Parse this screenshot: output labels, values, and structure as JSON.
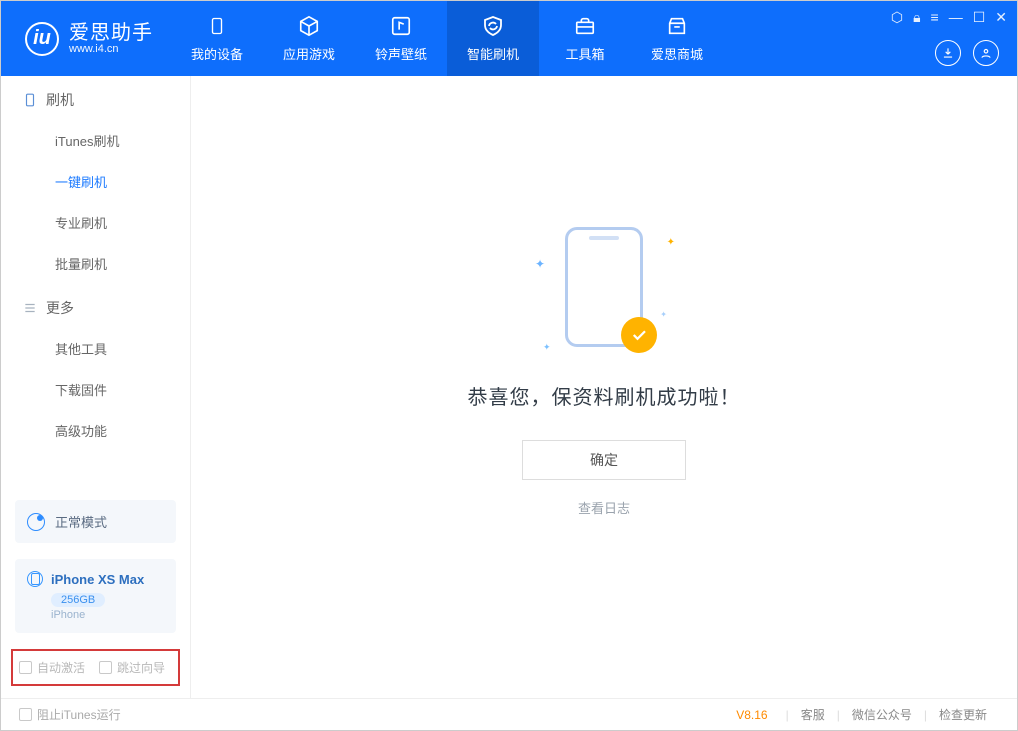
{
  "app": {
    "name": "爱思助手",
    "url": "www.i4.cn"
  },
  "nav": {
    "items": [
      {
        "label": "我的设备"
      },
      {
        "label": "应用游戏"
      },
      {
        "label": "铃声壁纸"
      },
      {
        "label": "智能刷机"
      },
      {
        "label": "工具箱"
      },
      {
        "label": "爱思商城"
      }
    ]
  },
  "sidebar": {
    "group1": {
      "title": "刷机",
      "items": [
        "iTunes刷机",
        "一键刷机",
        "专业刷机",
        "批量刷机"
      ]
    },
    "group2": {
      "title": "更多",
      "items": [
        "其他工具",
        "下载固件",
        "高级功能"
      ]
    }
  },
  "mode": {
    "label": "正常模式"
  },
  "device": {
    "name": "iPhone XS Max",
    "storage": "256GB",
    "type": "iPhone"
  },
  "options": {
    "autoActivate": "自动激活",
    "skipGuide": "跳过向导"
  },
  "main": {
    "successMessage": "恭喜您，保资料刷机成功啦！",
    "okButton": "确定",
    "viewLog": "查看日志"
  },
  "footer": {
    "blockItunes": "阻止iTunes运行",
    "version": "V8.16",
    "links": [
      "客服",
      "微信公众号",
      "检查更新"
    ]
  }
}
